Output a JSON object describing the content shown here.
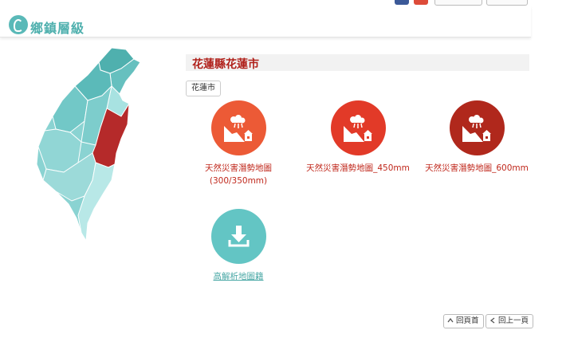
{
  "header": {
    "site_title": "鄉鎮層級"
  },
  "page": {
    "title": "花蓮縣花蓮市",
    "breadcrumb": "花蓮市"
  },
  "items": [
    {
      "label": "天然災害潛勢地圖\n(300/350mm)",
      "icon": "landslide-icon"
    },
    {
      "label": "天然災害潛勢地圖_450mm",
      "icon": "landslide-icon"
    },
    {
      "label": "天然災害潛勢地圖_600mm",
      "icon": "landslide-icon"
    },
    {
      "label": "高解析地圖籍",
      "icon": "download-icon"
    }
  ],
  "nav": {
    "home": "回頁首",
    "back": "回上一頁"
  },
  "colors": {
    "accent_teal": "#5ab9b8",
    "red_light": "#ec5a36",
    "red_mid": "#e23a28",
    "red_dark": "#b0281c",
    "highlight_region": "#b52a2a"
  }
}
